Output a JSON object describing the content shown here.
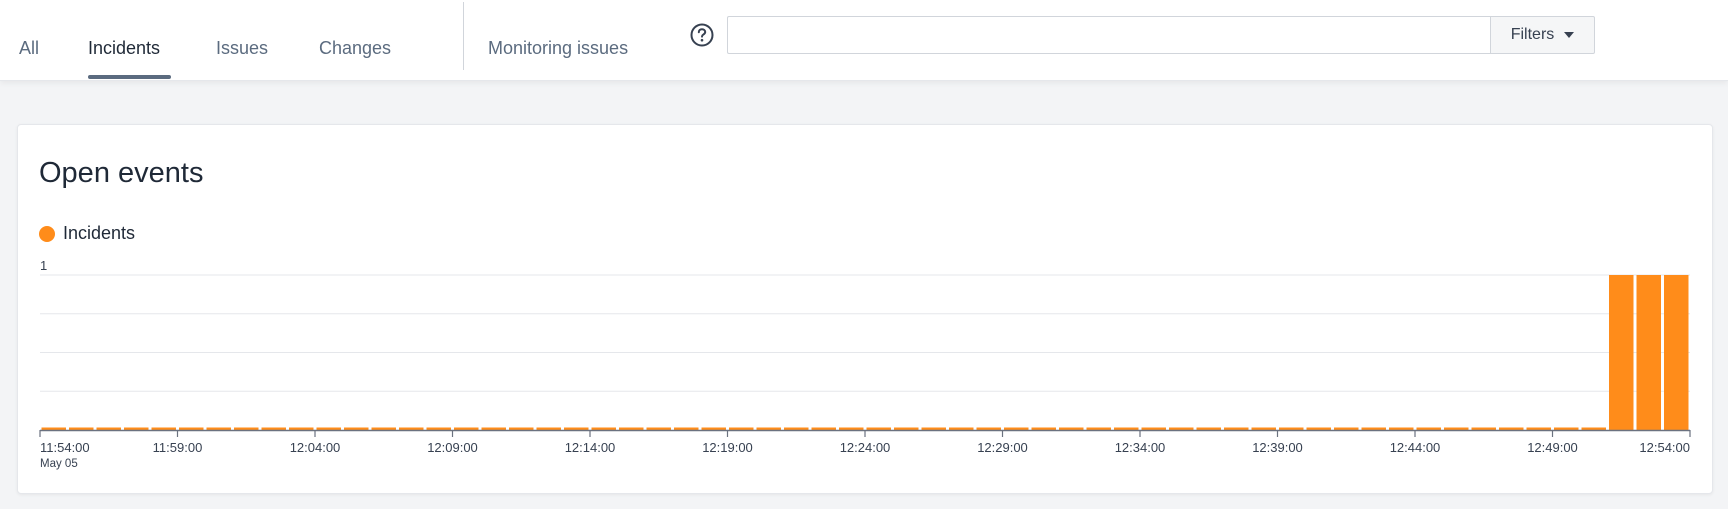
{
  "tabs": [
    {
      "label": "All",
      "active": false
    },
    {
      "label": "Incidents",
      "active": true
    },
    {
      "label": "Issues",
      "active": false
    },
    {
      "label": "Changes",
      "active": false
    },
    {
      "label": "Monitoring issues",
      "active": false
    }
  ],
  "search": {
    "value": "",
    "placeholder": ""
  },
  "filters": {
    "label": "Filters"
  },
  "icons": {
    "help": "question-circle-icon",
    "filters_caret": "caret-down-icon"
  },
  "colors": {
    "accent": "#ff8c1a",
    "tab_active_underline": "#5b6b7f"
  },
  "card": {
    "title": "Open events"
  },
  "chart_data": {
    "type": "bar",
    "title": "Open events",
    "xlabel": "",
    "ylabel": "",
    "date_label": "May 05",
    "ylim": [
      0,
      1
    ],
    "y_ticks": [
      "1"
    ],
    "grid": true,
    "legend_position": "top-left",
    "x_tick_labels": [
      "11:54:00",
      "11:59:00",
      "12:04:00",
      "12:09:00",
      "12:14:00",
      "12:19:00",
      "12:24:00",
      "12:29:00",
      "12:34:00",
      "12:39:00",
      "12:44:00",
      "12:49:00",
      "12:54:00"
    ],
    "series": [
      {
        "name": "Incidents",
        "color": "#ff8c1a",
        "x": [
          "11:54:00",
          "11:55:00",
          "11:56:00",
          "11:57:00",
          "11:58:00",
          "11:59:00",
          "12:00:00",
          "12:01:00",
          "12:02:00",
          "12:03:00",
          "12:04:00",
          "12:05:00",
          "12:06:00",
          "12:07:00",
          "12:08:00",
          "12:09:00",
          "12:10:00",
          "12:11:00",
          "12:12:00",
          "12:13:00",
          "12:14:00",
          "12:15:00",
          "12:16:00",
          "12:17:00",
          "12:18:00",
          "12:19:00",
          "12:20:00",
          "12:21:00",
          "12:22:00",
          "12:23:00",
          "12:24:00",
          "12:25:00",
          "12:26:00",
          "12:27:00",
          "12:28:00",
          "12:29:00",
          "12:30:00",
          "12:31:00",
          "12:32:00",
          "12:33:00",
          "12:34:00",
          "12:35:00",
          "12:36:00",
          "12:37:00",
          "12:38:00",
          "12:39:00",
          "12:40:00",
          "12:41:00",
          "12:42:00",
          "12:43:00",
          "12:44:00",
          "12:45:00",
          "12:46:00",
          "12:47:00",
          "12:48:00",
          "12:49:00",
          "12:50:00",
          "12:51:00",
          "12:52:00",
          "12:53:00"
        ],
        "values": [
          0,
          0,
          0,
          0,
          0,
          0,
          0,
          0,
          0,
          0,
          0,
          0,
          0,
          0,
          0,
          0,
          0,
          0,
          0,
          0,
          0,
          0,
          0,
          0,
          0,
          0,
          0,
          0,
          0,
          0,
          0,
          0,
          0,
          0,
          0,
          0,
          0,
          0,
          0,
          0,
          0,
          0,
          0,
          0,
          0,
          0,
          0,
          0,
          0,
          0,
          0,
          0,
          0,
          0,
          0,
          0,
          0,
          1,
          1,
          1
        ]
      }
    ]
  }
}
